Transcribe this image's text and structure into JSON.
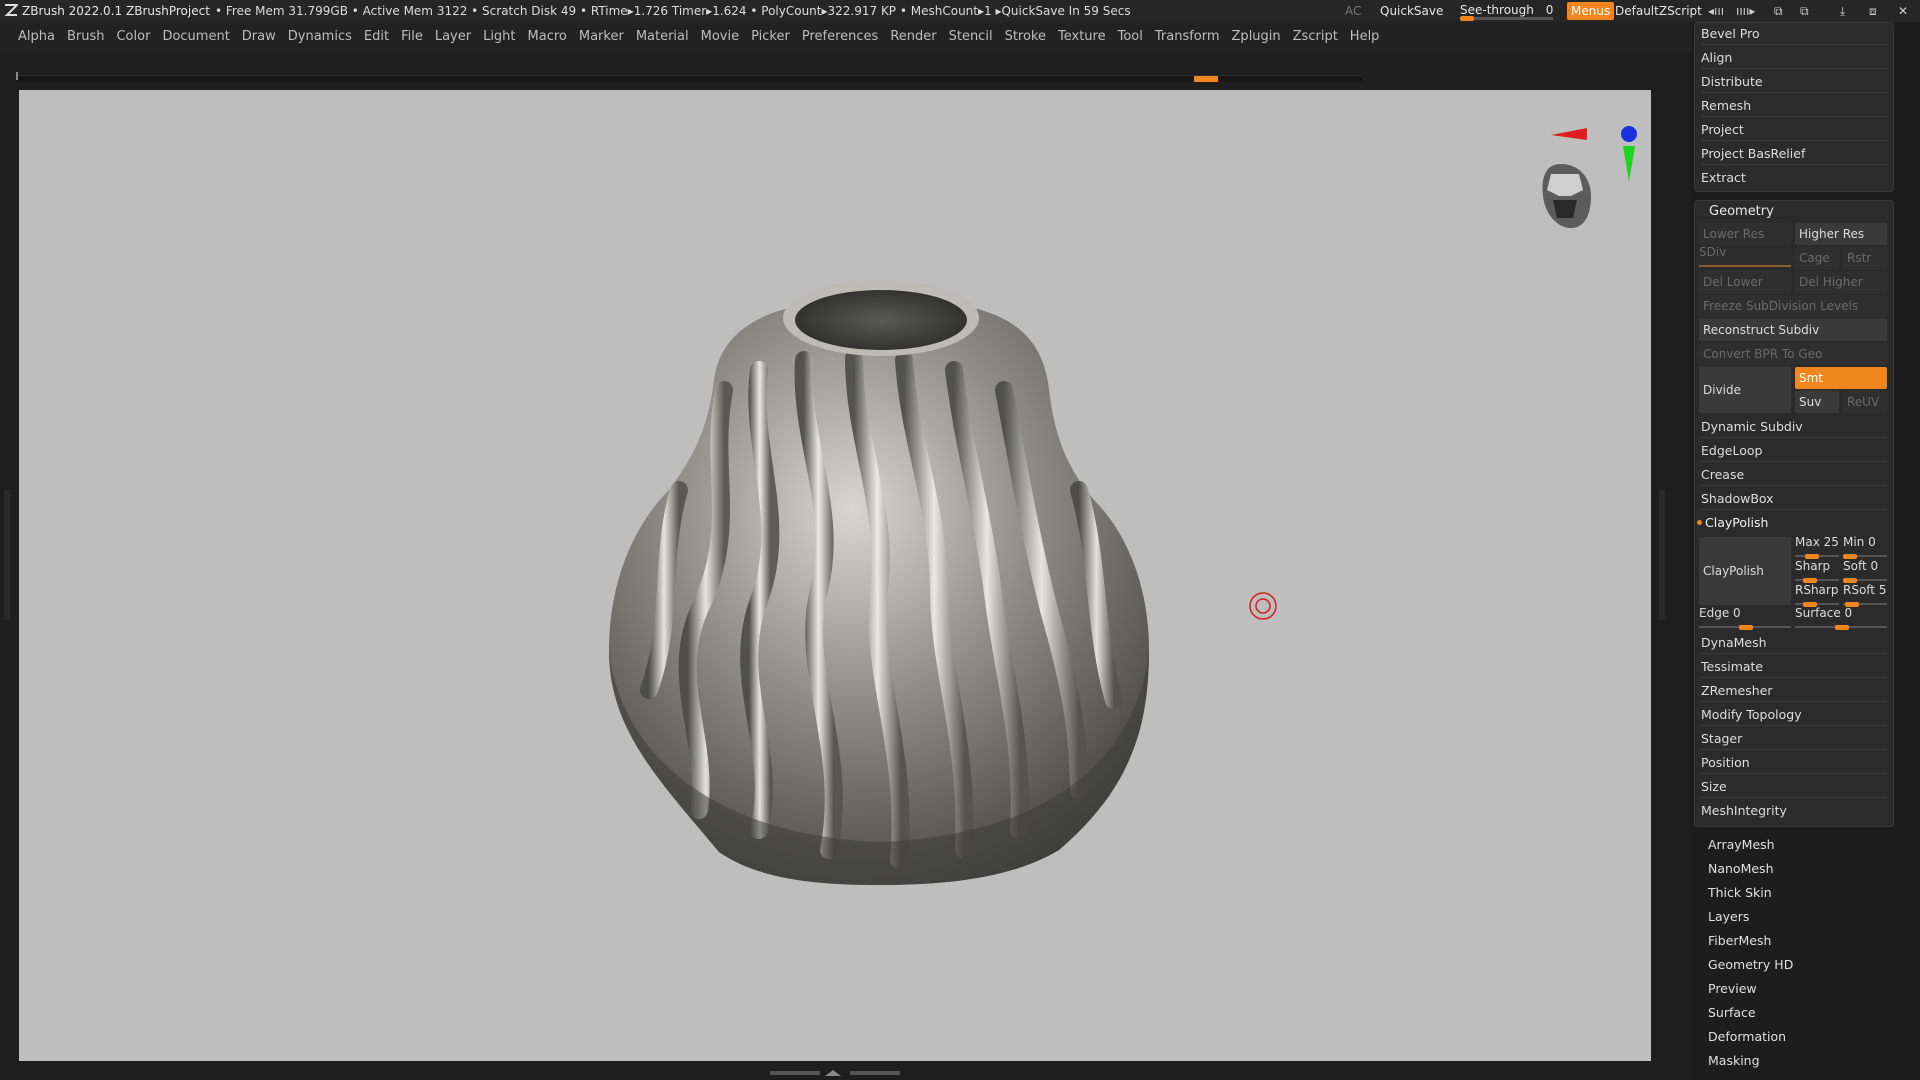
{
  "titlebar": {
    "app": "ZBrush 2022.0.1",
    "project": "ZBrushProject",
    "stats": "• Free Mem 31.799GB • Active Mem 3122 • Scratch Disk 49 • RTime▸1.726 Timer▸1.624 • PolyCount▸322.917 KP • MeshCount▸1 ▸QuickSave In 59 Secs",
    "ac": "AC",
    "quicksave": "QuickSave",
    "see_through_label": "See-through",
    "see_through_value": "0",
    "see_through_level": 0,
    "menus": "Menus",
    "default_zscript": "DefaultZScript",
    "window_controls": [
      "◂ııı",
      "ıııı▸",
      "⧉",
      "⧉",
      "⤓",
      "⧈",
      "✕"
    ]
  },
  "menubar": [
    "Alpha",
    "Brush",
    "Color",
    "Document",
    "Draw",
    "Dynamics",
    "Edit",
    "File",
    "Layer",
    "Light",
    "Macro",
    "Marker",
    "Material",
    "Movie",
    "Picker",
    "Preferences",
    "Render",
    "Stencil",
    "Stroke",
    "Texture",
    "Tool",
    "Transform",
    "Zplugin",
    "Zscript",
    "Help"
  ],
  "colors": {
    "accent": "#f0861d",
    "panel": "#2b2b2b",
    "viewport": "#bebebe",
    "gyro_x": "#e01e1e",
    "gyro_y": "#1bd41b",
    "gyro_z": "#1a2fe0"
  },
  "icons": {
    "logo": "zbrush-logo-icon",
    "gyro": "navigation-gyro-icon",
    "head": "orientation-head-icon",
    "cursor": "brush-cursor-icon",
    "scroll": "viewport-scroll-icon"
  },
  "panel": {
    "top_items": [
      "Bevel Pro",
      "Align",
      "Distribute",
      "Remesh",
      "Project",
      "Project BasRelief",
      "Extract"
    ],
    "geometry": {
      "title": "Geometry",
      "lower_res": "Lower Res",
      "higher_res": "Higher Res",
      "sdiv": "SDiv",
      "cage": "Cage",
      "rstr": "Rstr",
      "del_lower": "Del Lower",
      "del_higher": "Del Higher",
      "freeze": "Freeze SubDivision Levels",
      "reconstruct": "Reconstruct Subdiv",
      "convert_bpr": "Convert BPR To Geo",
      "divide": "Divide",
      "smt": "Smt",
      "suv": "Suv",
      "reuv": "ReUV",
      "items": [
        "Dynamic Subdiv",
        "EdgeLoop",
        "Crease",
        "ShadowBox"
      ],
      "claypolish_header": "ClayPolish",
      "claypolish_btn": "ClayPolish",
      "max": {
        "label": "Max 25",
        "level": 0.25
      },
      "min": {
        "label": "Min 0",
        "level": 0
      },
      "sharp": {
        "label": "Sharp",
        "level": 0.3
      },
      "soft": {
        "label": "Soft 0",
        "level": 0
      },
      "rsharp": {
        "label": "RSharp",
        "level": 0.3
      },
      "rsoft": {
        "label": "RSoft 5",
        "level": 0.05
      },
      "edge": {
        "label": "Edge 0",
        "level": 0
      },
      "surface": {
        "label": "Surface 0",
        "level": 0
      },
      "items2": [
        "DynaMesh",
        "Tessimate",
        "ZRemesher",
        "Modify Topology",
        "Stager",
        "Position",
        "Size",
        "MeshIntegrity"
      ]
    },
    "bottom_items": [
      "ArrayMesh",
      "NanoMesh",
      "Thick Skin",
      "Layers",
      "FiberMesh",
      "Geometry HD",
      "Preview",
      "Surface",
      "Deformation",
      "Masking"
    ]
  }
}
